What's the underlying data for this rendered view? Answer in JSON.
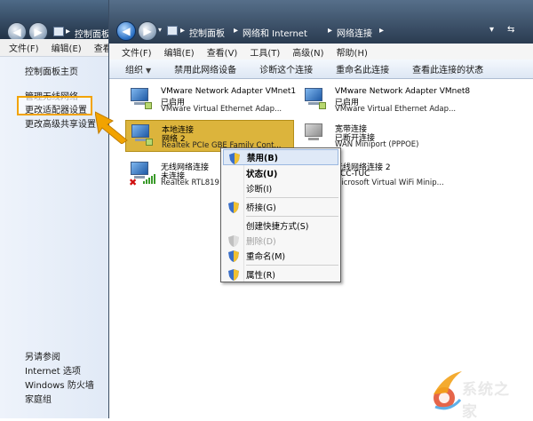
{
  "back_window": {
    "breadcrumb": "控制面板",
    "menu": [
      "文件(F)",
      "编辑(E)",
      "查看"
    ],
    "nav_top": [
      "控制面板主页",
      "管理无线网络",
      "更改适配器设置",
      "更改高级共享设置"
    ],
    "see_also": "另请参阅",
    "nav_bottom": [
      "Internet 选项",
      "Windows 防火墙",
      "家庭组"
    ]
  },
  "front_window": {
    "breadcrumb": [
      "控制面板",
      "网络和 Internet",
      "网络连接"
    ],
    "menu": [
      "文件(F)",
      "编辑(E)",
      "查看(V)",
      "工具(T)",
      "高级(N)",
      "帮助(H)"
    ],
    "toolbar": [
      "组织",
      "禁用此网络设备",
      "诊断这个连接",
      "重命名此连接",
      "查看此连接的状态"
    ],
    "toolbar_more": "»",
    "adapters": [
      {
        "name": "VMware Network Adapter VMnet1",
        "status": "已启用",
        "desc": "VMware Virtual Ethernet Adap..."
      },
      {
        "name": "VMware Network Adapter VMnet8",
        "status": "已启用",
        "desc": "VMware Virtual Ethernet Adap..."
      },
      {
        "name": "本地连接",
        "status": "网络  2",
        "desc": "Realtek PCIe GBE Family Cont..."
      },
      {
        "name": "宽带连接",
        "status": "已断开连接",
        "desc": "WAN Miniport (PPPOE)"
      },
      {
        "name": "无线网络连接",
        "status": "未连接",
        "desc": "Realtek RTL819"
      },
      {
        "name": "无线网络连接 2",
        "status": "ACC-TUC",
        "desc": "Microsoft Virtual WiFi Minip..."
      }
    ]
  },
  "context_menu": {
    "items": [
      "禁用(B)",
      "状态(U)",
      "诊断(I)",
      "桥接(G)",
      "创建快捷方式(S)",
      "删除(D)",
      "重命名(M)",
      "属性(R)"
    ]
  },
  "watermark": "系统之家",
  "colors": {
    "selection": "#dcb43c",
    "highlight_box": "#f2a300",
    "arrow": "#f2a300"
  }
}
